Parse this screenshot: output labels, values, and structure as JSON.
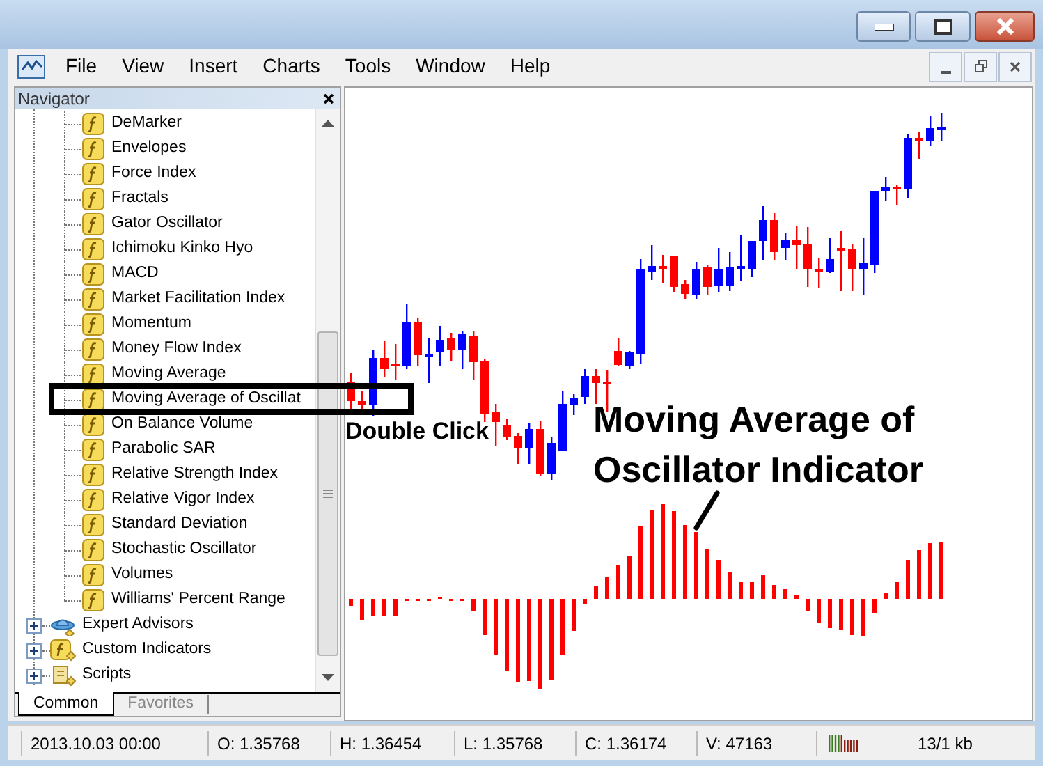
{
  "menu": [
    "File",
    "View",
    "Insert",
    "Charts",
    "Tools",
    "Window",
    "Help"
  ],
  "navigator": {
    "title": "Navigator",
    "indicators": [
      {
        "label": "DeMarker",
        "boxed": false
      },
      {
        "label": "Envelopes",
        "boxed": false
      },
      {
        "label": "Force Index",
        "boxed": false
      },
      {
        "label": "Fractals",
        "boxed": false
      },
      {
        "label": "Gator Oscillator",
        "boxed": false
      },
      {
        "label": "Ichimoku Kinko Hyo",
        "boxed": false
      },
      {
        "label": "MACD",
        "boxed": false
      },
      {
        "label": "Market Facilitation Index",
        "boxed": false
      },
      {
        "label": "Momentum",
        "boxed": false
      },
      {
        "label": "Money Flow Index",
        "boxed": false
      },
      {
        "label": "Moving Average",
        "boxed": false
      },
      {
        "label": "Moving Average of Oscillat",
        "boxed": true
      },
      {
        "label": "On Balance Volume",
        "boxed": false
      },
      {
        "label": "Parabolic SAR",
        "boxed": false
      },
      {
        "label": "Relative Strength Index",
        "boxed": false
      },
      {
        "label": "Relative Vigor Index",
        "boxed": false
      },
      {
        "label": "Standard Deviation",
        "boxed": false
      },
      {
        "label": "Stochastic Oscillator",
        "boxed": false
      },
      {
        "label": "Volumes",
        "boxed": false
      },
      {
        "label": "Williams' Percent Range",
        "boxed": false
      }
    ],
    "folders": [
      {
        "label": "Expert Advisors",
        "kind": "experts",
        "expanded": false
      },
      {
        "label": "Custom Indicators",
        "kind": "custom",
        "expanded": false
      },
      {
        "label": "Scripts",
        "kind": "scripts",
        "expanded": false
      }
    ],
    "tabs": [
      {
        "label": "Common",
        "selected": true
      },
      {
        "label": "Favorites",
        "selected": false
      }
    ]
  },
  "chart": {
    "click_hint": "Double Click",
    "callout": "Moving Average of Oscillator Indicator"
  },
  "status_bar": [
    "2013.10.03 00:00",
    "O: 1.35768",
    "H: 1.36454",
    "L: 1.35768",
    "C: 1.36174",
    "V: 47163",
    "13/1 kb"
  ]
}
